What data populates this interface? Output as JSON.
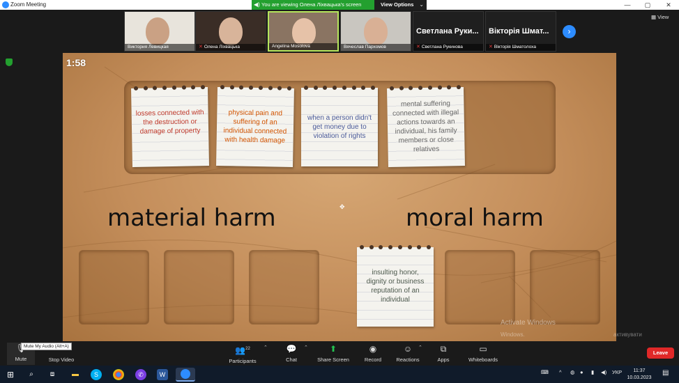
{
  "window": {
    "title": "Zoom Meeting",
    "controls": [
      "—",
      "▢",
      "✕"
    ]
  },
  "share_banner": {
    "text": "You are viewing Олена Ліхвацька's screen",
    "view_options": "View Options"
  },
  "participants_strip": [
    {
      "name": "Виктория Левицкая",
      "muted": false,
      "active": false
    },
    {
      "name": "Олена Ліхвацька",
      "muted": true,
      "active": false
    },
    {
      "name": "Angelina Mosolova",
      "muted": false,
      "active": true
    },
    {
      "name": "Вячеслав Пархомов",
      "muted": false,
      "active": false
    },
    {
      "name": "Светлана Рукинова",
      "display": "Светлана Руки...",
      "muted": true,
      "active": false
    },
    {
      "name": "Вікторія Шматолоха",
      "display": "Вікторія Шмат...",
      "muted": true,
      "active": false
    }
  ],
  "view_button": "View",
  "board": {
    "timer": "1:58",
    "notes_top": [
      "losses connected with the destruction or damage of property",
      "physical pain and suffering of an individual connected with health damage",
      "when a person didn't get money due to violation of rights",
      "mental suffering connected with illegal actions towards an individual, his family members or close relatives"
    ],
    "note_colors": [
      "#c0392b",
      "#d35400",
      "#4a5a9a",
      "#666666"
    ],
    "heading_left": "material harm",
    "heading_right": "moral harm",
    "placed_note": "insulting honor, dignity or business reputation of an individual",
    "placed_note_color": "#4d5a4d",
    "watermark_1": "Activate Windows",
    "watermark_2": "Windows.",
    "watermark_3": "активувати"
  },
  "toolbar": {
    "mute": "Mute",
    "mute_tooltip": "Mute My Audio (Alt+A)",
    "stop_video": "Stop Video",
    "participants": "Participants",
    "participants_count": "22",
    "chat": "Chat",
    "share_screen": "Share Screen",
    "record": "Record",
    "reactions": "Reactions",
    "apps": "Apps",
    "whiteboards": "Whiteboards",
    "leave": "Leave"
  },
  "taskbar": {
    "lang": "УКР",
    "time": "11:37",
    "date": "10.03.2023"
  }
}
